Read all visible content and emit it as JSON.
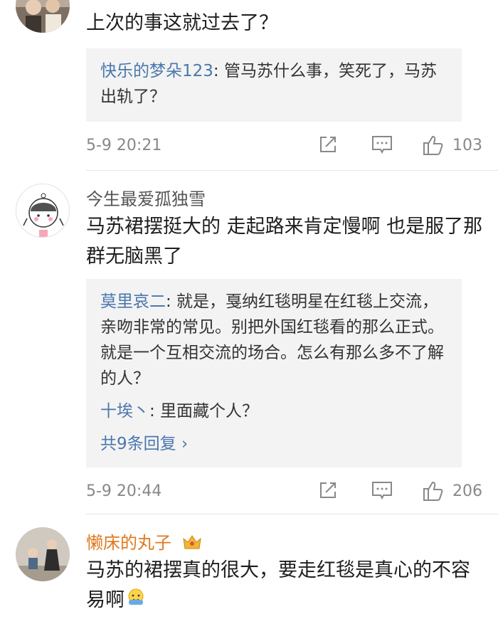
{
  "comment1": {
    "text": "上次的事这就过去了？",
    "replies": [
      {
        "name": "快乐的梦朵123",
        "text": ": 管马苏什么事，笑死了，马苏出轨了？"
      }
    ],
    "time": "5-9 20:21",
    "likes": "103"
  },
  "comment2": {
    "user": "今生最爱孤独雪",
    "text": "马苏裙摆挺大的 走起路来肯定慢啊 也是服了那群无脑黑了",
    "replies": [
      {
        "name": "莫里哀二",
        "text": ": 就是，戛纳红毯明星在红毯上交流，亲吻非常的常见。别把外国红毯看的那么正式。就是一个互相交流的场合。怎么有那么多不了解的人？"
      },
      {
        "name": "十埃丶",
        "text": ": 里面藏个人？"
      }
    ],
    "more": "共9条回复 ›",
    "time": "5-9 20:44",
    "likes": "206"
  },
  "comment3": {
    "user": "懒床的丸子",
    "text": "马苏的裙摆真的很大，要走红毯是真心的不容易啊"
  },
  "icons": [
    "share-icon",
    "comment-icon",
    "like-icon",
    "vip-crown-icon",
    "shy-emoji-icon"
  ],
  "colors": {
    "link": "#4a77ad",
    "vip_name": "#e0791f",
    "reply_bg": "#f3f3f3"
  }
}
